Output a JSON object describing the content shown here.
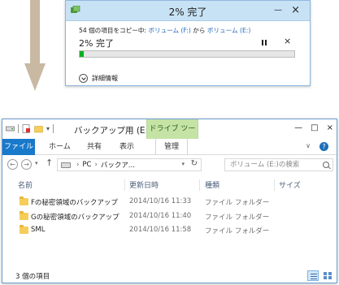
{
  "dialog": {
    "title": "2% 完了",
    "copy_prefix": "54 個の項目をコピー中: ",
    "source": "ボリューム (F:)",
    "connector": " から ",
    "destination": "ボリューム (E:)",
    "percent_text": "2% 完了",
    "progress_percent": 2,
    "details_label": "詳細情報",
    "pause_icon": "pause-icon",
    "stop_icon": "close-icon"
  },
  "explorer": {
    "title": "バックアップ用 (E:)",
    "context_tab": "ドライブ ツール",
    "ribbon_tabs": [
      "ファイル",
      "ホーム",
      "共有",
      "表示",
      "管理"
    ],
    "address": {
      "pc": "PC",
      "current": "バックア..."
    },
    "search_placeholder": "ボリューム (E:)の検索",
    "columns": [
      "名前",
      "更新日時",
      "種類",
      "サイズ"
    ],
    "rows": [
      {
        "name": "Fの秘密領域のバックアップ",
        "date": "2014/10/16 11:33",
        "type": "ファイル フォルダー"
      },
      {
        "name": "Gの秘密領域のバックアップ",
        "date": "2014/10/16 11:40",
        "type": "ファイル フォルダー"
      },
      {
        "name": "SML",
        "date": "2014/10/16 11:58",
        "type": "ファイル フォルダー"
      }
    ],
    "status": "3 個の項目"
  },
  "colors": {
    "progress": "#06b025",
    "file_tab": "#1979ca",
    "drive_tools": "#c4e3a5",
    "arrow": "#c9b9a3"
  }
}
